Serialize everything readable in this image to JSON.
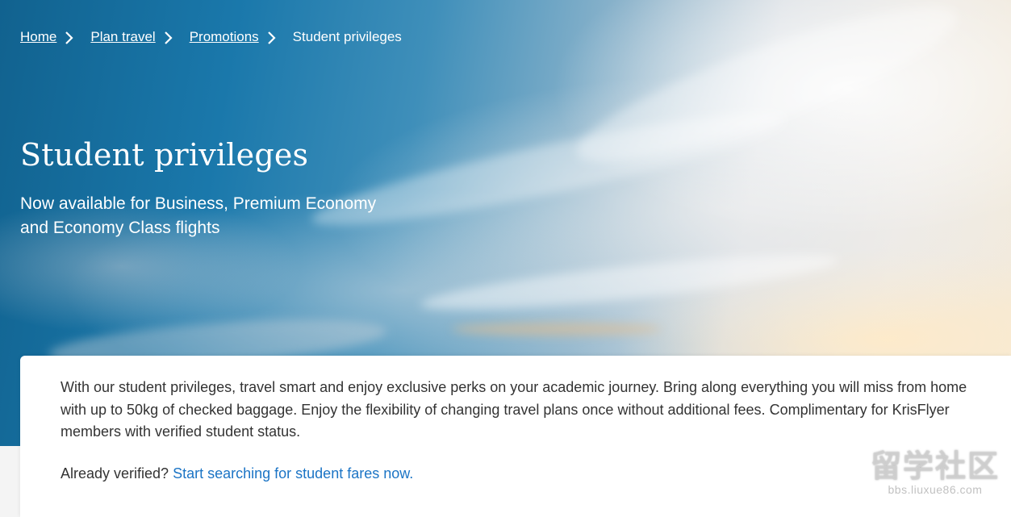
{
  "breadcrumb": {
    "items": [
      {
        "label": "Home"
      },
      {
        "label": "Plan travel"
      },
      {
        "label": "Promotions"
      }
    ],
    "current": "Student privileges"
  },
  "hero": {
    "title": "Student privileges",
    "subtitle": "Now available for Business, Premium Economy and Economy Class flights"
  },
  "content": {
    "body": "With our student privileges, travel smart and enjoy exclusive perks on your academic journey. Bring along everything you will miss from home with up to 50kg of checked baggage. Enjoy the flexibility of changing travel plans once without additional fees. Complimentary for KrisFlyer members with verified student status.",
    "cta_prefix": "Already verified?",
    "cta_link": "Start searching for student fares now."
  },
  "watermark": {
    "logo": "留学社区",
    "url": "bbs.liuxue86.com"
  },
  "colors": {
    "link_blue": "#1b74c5",
    "body_text": "#333333",
    "sky_blue": "#1a78ab"
  },
  "icons": {
    "breadcrumb_separator": "chevron-right-icon"
  }
}
